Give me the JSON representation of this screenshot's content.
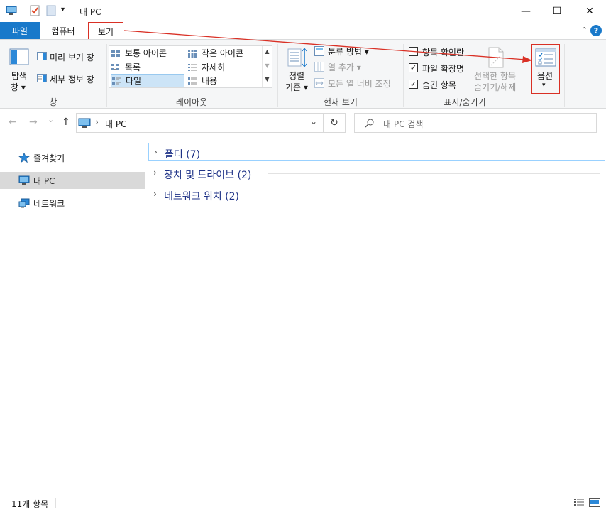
{
  "window": {
    "title": "내 PC",
    "minimize_glyph": "—",
    "maximize_glyph": "☐",
    "close_glyph": "✕"
  },
  "quick_access": {
    "dropdown_glyph": "▾"
  },
  "tabs": {
    "file": "파일",
    "computer": "컴퓨터",
    "view": "보기",
    "help": "?",
    "collapse": "⌃"
  },
  "ribbon": {
    "panes": {
      "label": "창",
      "navigation_pane": "탐색",
      "navigation_pane_2": "창 ▾",
      "preview_pane": "미리 보기 창",
      "details_pane": "세부 정보 창"
    },
    "layout": {
      "label": "레이아웃",
      "items": [
        "보통 아이콘",
        "작은 아이콘",
        "목록",
        "자세히",
        "타일",
        "내용"
      ],
      "selected": "타일"
    },
    "current_view": {
      "label": "현재 보기",
      "sort_by": "정렬",
      "sort_by_2": "기준 ▾",
      "group_by": "분류 방법 ▾",
      "add_columns": "열 추가 ▾",
      "size_all_columns": "모든 열 너비 조정"
    },
    "show_hide": {
      "label": "표시/숨기기",
      "item_checkboxes": "항목 확인란",
      "file_extensions": "파일 확장명",
      "hidden_items": "숨긴 항목",
      "item_checkboxes_checked": false,
      "file_extensions_checked": true,
      "hidden_items_checked": true,
      "hide_selected": "선택한 항목",
      "hide_selected_2": "숨기기/해제"
    },
    "options": {
      "label": "옵션",
      "dropdown": "▾"
    }
  },
  "navigation": {
    "back": "←",
    "forward": "→",
    "recent": "⌄",
    "up": "↑",
    "path_separator": "›",
    "address": "내 PC",
    "dropdown": "⌄",
    "refresh": "↻",
    "search_placeholder": "내 PC 검색"
  },
  "sidebar": {
    "items": [
      {
        "label": "즐겨찾기",
        "icon": "star-icon"
      },
      {
        "label": "내 PC",
        "icon": "computer-icon",
        "selected": true
      },
      {
        "label": "네트워크",
        "icon": "network-icon"
      }
    ]
  },
  "content": {
    "groups": [
      {
        "name": "폴더 (7)"
      },
      {
        "name": "장치 및 드라이브 (2)"
      },
      {
        "name": "네트워크 위치 (2)"
      }
    ],
    "chevron": "›"
  },
  "status": {
    "item_count": "11개 항목"
  },
  "colors": {
    "accent": "#1979ca",
    "annotation": "#d93025",
    "group_header": "#1e3287",
    "selection": "#cce4f7"
  }
}
